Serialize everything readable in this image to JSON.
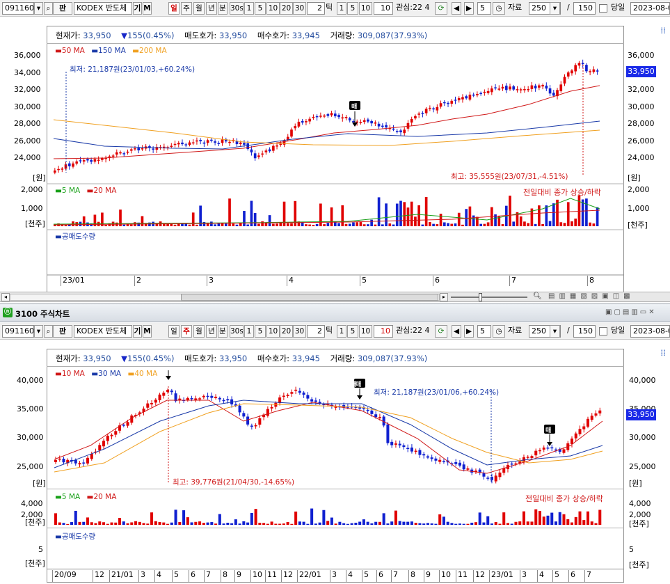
{
  "toolbar": {
    "code": "091160",
    "type_btn": "판",
    "stock_name": "KODEX 반도체",
    "btn_gi": "기",
    "btn_m": "M",
    "periods": [
      "일",
      "주",
      "월",
      "년",
      "분",
      "30s",
      "1",
      "5",
      "10",
      "20",
      "30"
    ],
    "tick_value": "2",
    "tick_label": "틱",
    "tick_periods": [
      "1",
      "5",
      "10"
    ],
    "tick_input": "10",
    "watch": "관심:22 4",
    "refresh_val": "5",
    "data_label": "자료",
    "data_count": "250",
    "slash": "/",
    "data_total": "150",
    "same_day": "당일",
    "date": "2023-08-0"
  },
  "info": {
    "price_label": "현재가:",
    "price": "33,950",
    "change_arrow": "▼",
    "change": "155(0.45%)",
    "ask_label": "매도호가:",
    "ask": "33,950",
    "bid_label": "매수호가:",
    "bid": "33,945",
    "volume_label": "거래량:",
    "volume": "309,087(37.93%)"
  },
  "chart1": {
    "ma_legend": [
      {
        "label": "50 MA",
        "color": "#d01818"
      },
      {
        "label": "150 MA",
        "color": "#1a3aa8"
      },
      {
        "label": "200 MA",
        "color": "#f0a020"
      }
    ],
    "y_ticks": [
      "36,000",
      "34,000",
      "32,000",
      "30,000",
      "28,000",
      "26,000",
      "24,000"
    ],
    "price_tag": "33,950",
    "unit_price": "[원]",
    "low_annotation": "최저: 21,187원(23/01/03,+60.24%)",
    "high_annotation": "최고: 35,555원(23/07/31,-4.51%)",
    "sell_marker": "매",
    "vol_legend": [
      {
        "label": "5 MA",
        "color": "#18a018"
      },
      {
        "label": "20 MA",
        "color": "#d01818"
      }
    ],
    "vol_note": "전일대비 종가 상승/하락",
    "vol_ticks": [
      "2,000",
      "1,000"
    ],
    "unit_vol": "[천주]",
    "short_legend": "공매도수량",
    "x_labels": [
      "23/01",
      "2",
      "3",
      "4",
      "5",
      "6",
      "7",
      "8"
    ]
  },
  "panel2": {
    "title": "3100 주식차트",
    "ma_legend": [
      {
        "label": "10 MA",
        "color": "#d01818"
      },
      {
        "label": "30 MA",
        "color": "#1a3aa8"
      },
      {
        "label": "40 MA",
        "color": "#f0a020"
      }
    ],
    "y_ticks": [
      "40,000",
      "35,000",
      "30,000",
      "25,000"
    ],
    "price_tag": "33,950",
    "unit_price": "[원]",
    "low_annotation": "최저: 21,187원(23/01/06,+60.24%)",
    "high_annotation": "최고: 39,776원(21/04/30,-14.65%)",
    "sell_marker": "매",
    "vol_legend": [
      {
        "label": "5 MA",
        "color": "#18a018"
      },
      {
        "label": "20 MA",
        "color": "#d01818"
      }
    ],
    "vol_note": "전일대비 종가 상승/하락",
    "vol_ticks": [
      "4,000",
      "2,000"
    ],
    "unit_vol": "[천주]",
    "short_legend": "공매도수량",
    "short_ticks": [
      "5",
      "5"
    ],
    "x_labels": [
      "20/09",
      "12",
      "21/01",
      "3",
      "4",
      "5",
      "6",
      "7",
      "8",
      "9",
      "10",
      "11",
      "12",
      "22/01",
      "3",
      "4",
      "5",
      "6",
      "7",
      "8",
      "9",
      "10",
      "11",
      "12",
      "23/01",
      "3",
      "4",
      "5",
      "6",
      "7"
    ]
  },
  "colors": {
    "up": "#e00000",
    "down": "#1020d0",
    "accent": "#2040e0"
  }
}
